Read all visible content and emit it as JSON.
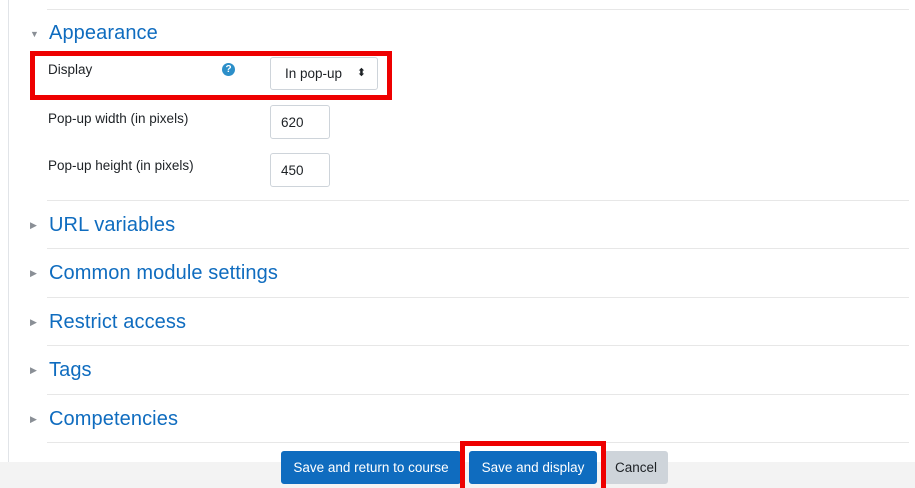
{
  "sections": {
    "appearance": {
      "title": "Appearance",
      "expanded": true,
      "toggle_icon": "caret-down-icon"
    },
    "url_variables": {
      "title": "URL variables",
      "toggle_icon": "caret-right-icon"
    },
    "common_module_settings": {
      "title": "Common module settings",
      "toggle_icon": "caret-right-icon"
    },
    "restrict_access": {
      "title": "Restrict access",
      "toggle_icon": "caret-right-icon"
    },
    "tags": {
      "title": "Tags",
      "toggle_icon": "caret-right-icon"
    },
    "competencies": {
      "title": "Competencies",
      "toggle_icon": "caret-right-icon"
    }
  },
  "appearance_fields": {
    "display": {
      "label": "Display",
      "help_icon": "question-circle-icon",
      "help_glyph": "?",
      "selected": "In pop-up",
      "arrow_glyph": "⬍"
    },
    "popup_width": {
      "label": "Pop-up width (in pixels)",
      "value": "620"
    },
    "popup_height": {
      "label": "Pop-up height (in pixels)",
      "value": "450"
    }
  },
  "buttons": {
    "save_return": "Save and return to course",
    "save_display": "Save and display",
    "cancel": "Cancel"
  },
  "colors": {
    "link_blue": "#0f6cbf",
    "primary_button": "#0f6cbf",
    "secondary_button": "#ced4da",
    "highlight_red": "#ee0000",
    "help_icon": "#2c8fc9"
  }
}
